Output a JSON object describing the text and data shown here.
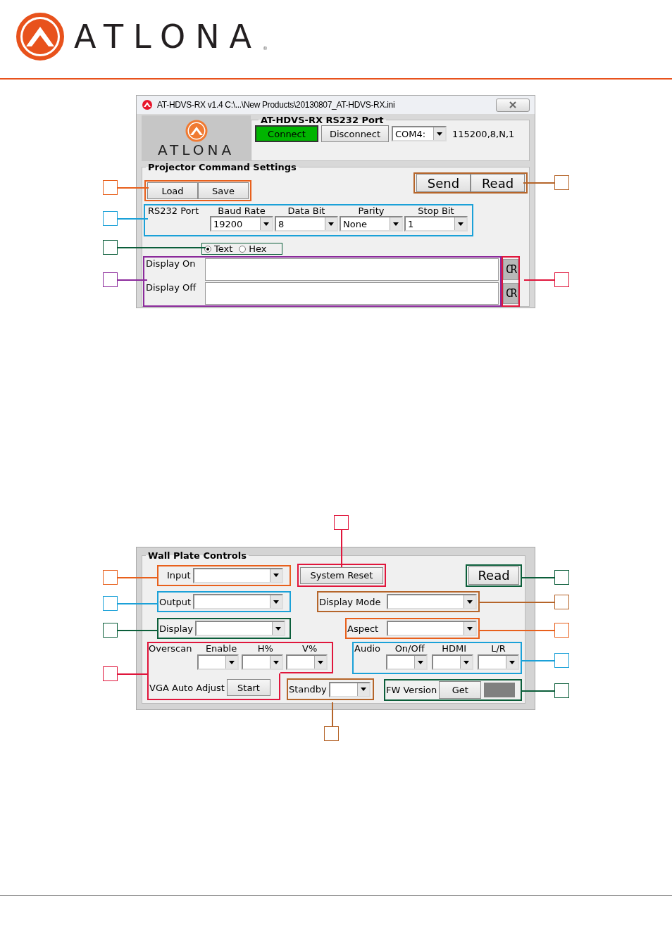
{
  "header": {
    "logo": "ATLONA",
    "registered_mark": "®"
  },
  "window": {
    "title": "AT-HDVS-RX v1.4 C:\\...\\New Products\\20130807_AT-HDVS-RX.ini",
    "brand": "ATLONA",
    "port": {
      "title": "AT-HDVS-RX RS232 Port",
      "connect": {
        "label": "Connect",
        "on": true
      },
      "disconnect": "Disconnect",
      "com_port": "COM4:",
      "settings": "115200,8,N,1"
    },
    "projector": {
      "title": "Projector Command Settings",
      "file_buttons": {
        "items": [
          "Load",
          "Save"
        ],
        "color": "#e8601c"
      },
      "action_buttons": {
        "items": [
          "Send",
          "Read"
        ],
        "color": "#b5652a"
      },
      "serial": {
        "label": "RS232 Port",
        "color": "#1ba1d8",
        "fields": [
          {
            "label": "Baud Rate",
            "value": "19200"
          },
          {
            "label": "Data Bit",
            "value": "8"
          },
          {
            "label": "Parity",
            "value": "None"
          },
          {
            "label": "Stop Bit",
            "value": "1"
          }
        ]
      },
      "format": {
        "color": "#0b5e3a",
        "options": [
          {
            "label": "Text",
            "selected": true
          },
          {
            "label": "Hex",
            "selected": false
          }
        ]
      },
      "commands": {
        "color": "#8b2a9b",
        "cr_buttons": {
          "color": "#e0163c"
        },
        "items": [
          {
            "label": "Display On",
            "cr": "CR"
          },
          {
            "label": "Display Off",
            "cr": "CR"
          }
        ]
      }
    }
  },
  "wall_plate": {
    "title": "Wall Plate Controls",
    "input": {
      "label": "Input",
      "color": "#e8601c"
    },
    "system_reset": {
      "label": "System Reset",
      "color": "#e0163c"
    },
    "read": {
      "label": "Read",
      "color": "#0b5e3a"
    },
    "output": {
      "label": "Output",
      "color": "#1ba1d8"
    },
    "display_mode": {
      "label": "Display Mode",
      "color": "#b5652a"
    },
    "display": {
      "label": "Display",
      "color": "#0b5e3a"
    },
    "aspect": {
      "label": "Aspect",
      "color": "#e8601c"
    },
    "overscan": {
      "label": "Overscan",
      "columns": [
        "Enable",
        "H%",
        "V%"
      ],
      "vga_label": "VGA Auto Adjust",
      "start": "Start",
      "color": "#e0163c"
    },
    "standby": {
      "label": "Standby",
      "color": "#b5652a"
    },
    "audio": {
      "label": "Audio",
      "columns": [
        "On/Off",
        "HDMI",
        "L/R"
      ],
      "color": "#1ba1d8"
    },
    "fw_version": {
      "label": "FW Version",
      "get": "Get",
      "color": "#0b5e3a"
    }
  }
}
